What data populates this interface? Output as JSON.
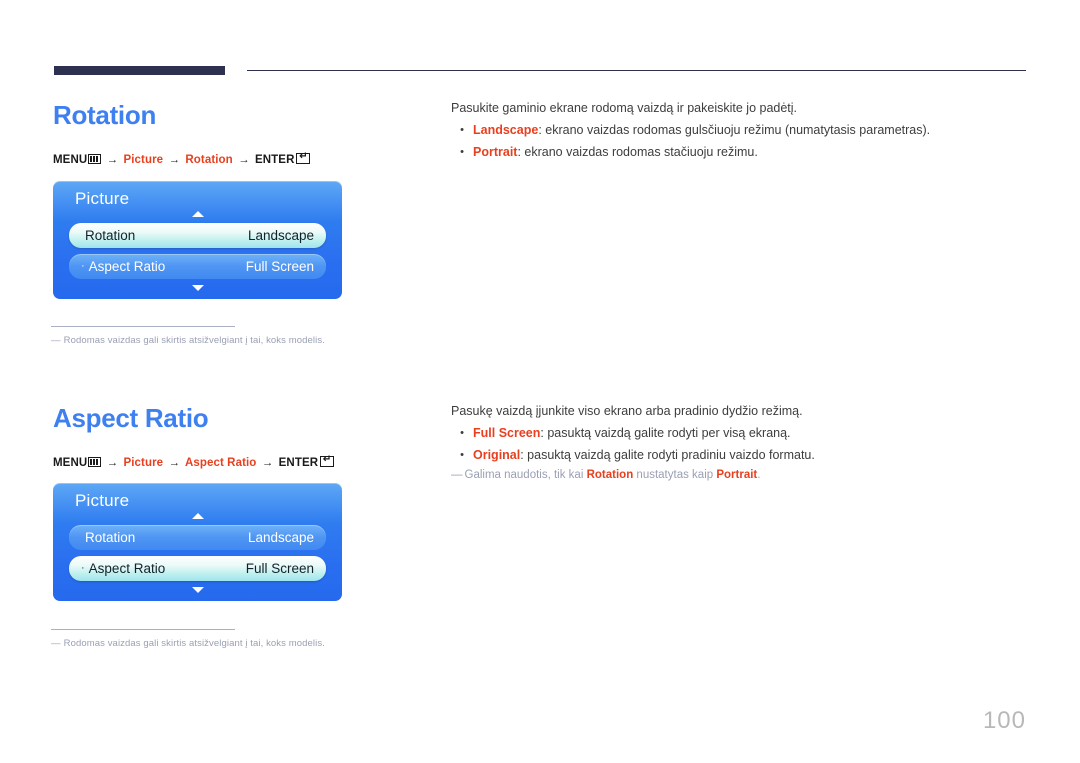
{
  "page": {
    "number": "100"
  },
  "sections": [
    {
      "title": "Rotation",
      "crumb": {
        "menu_label": "MENU",
        "menu_icon": "menu-grid-icon",
        "arrow": "→",
        "step1": "Picture",
        "step2": "Rotation",
        "enter_label": "ENTER",
        "enter_icon": "enter-key-icon"
      },
      "osd": {
        "title": "Picture",
        "arrow_up_icon": "triangle-up-icon",
        "arrow_down_icon": "triangle-down-icon",
        "rows": [
          {
            "label": "Rotation",
            "value": "Landscape",
            "selected": true,
            "dot": ""
          },
          {
            "label": "Aspect Ratio",
            "value": "Full Screen",
            "selected": false,
            "dot": "·"
          }
        ]
      },
      "footnote": "Rodomas vaizdas gali skirtis atsižvelgiant į tai, koks modelis.",
      "footnote_dash": "―",
      "body": {
        "lead": "Pasukite gaminio ekrane rodomą vaizdą ir pakeiskite jo padėtį.",
        "bullets": [
          {
            "dot": "•",
            "term": "Landscape",
            "rest": ": ekrano vaizdas rodomas gulsčiuoju režimu (numatytasis parametras)."
          },
          {
            "dot": "•",
            "term": "Portrait",
            "rest": ": ekrano vaizdas rodomas stačiuoju režimu."
          }
        ],
        "note": null
      }
    },
    {
      "title": "Aspect Ratio",
      "crumb": {
        "menu_label": "MENU",
        "menu_icon": "menu-grid-icon",
        "arrow": "→",
        "step1": "Picture",
        "step2": "Aspect Ratio",
        "enter_label": "ENTER",
        "enter_icon": "enter-key-icon"
      },
      "osd": {
        "title": "Picture",
        "arrow_up_icon": "triangle-up-icon",
        "arrow_down_icon": "triangle-down-icon",
        "rows": [
          {
            "label": "Rotation",
            "value": "Landscape",
            "selected": false,
            "dot": ""
          },
          {
            "label": "Aspect Ratio",
            "value": "Full Screen",
            "selected": true,
            "dot": "·"
          }
        ]
      },
      "footnote": "Rodomas vaizdas gali skirtis atsižvelgiant į tai, koks modelis.",
      "footnote_dash": "―",
      "body": {
        "lead": "Pasukę vaizdą įjunkite viso ekrano arba pradinio dydžio režimą.",
        "bullets": [
          {
            "dot": "•",
            "term": "Full Screen",
            "rest": ": pasuktą vaizdą galite rodyti per visą ekraną."
          },
          {
            "dot": "•",
            "term": "Original",
            "rest": ": pasuktą vaizdą galite rodyti pradiniu vaizdo formatu."
          }
        ],
        "note": {
          "dash": "―",
          "pre": "Galima naudotis, tik kai ",
          "term1": "Rotation",
          "mid": " nustatytas kaip ",
          "term2": "Portrait",
          "post": "."
        }
      }
    }
  ],
  "colors": {
    "heading": "#3f80f0",
    "accent": "#e8401f",
    "rule": "#2e3050",
    "muted": "#9aa0b4"
  }
}
